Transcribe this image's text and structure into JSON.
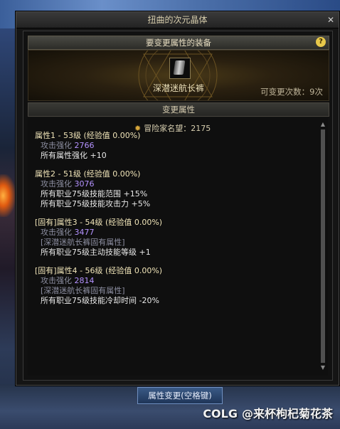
{
  "window": {
    "title": "扭曲的次元晶体"
  },
  "equipment": {
    "header": "要变更属性的装备",
    "item_name": "深潜迷航长裤",
    "change_count": "可变更次数：9次"
  },
  "attributes_header": "变更属性",
  "fame": {
    "label": "冒险家名望：2175"
  },
  "attributes": [
    {
      "title": "属性1 - 53级 (经验值 0.00%)",
      "lines": [
        {
          "label": "攻击强化",
          "value": "2766"
        },
        {
          "text": "所有属性强化 +10"
        }
      ]
    },
    {
      "title": "属性2 - 51级 (经验值 0.00%)",
      "lines": [
        {
          "label": "攻击强化",
          "value": "3076"
        },
        {
          "text": "所有职业75级技能范围 +15%"
        },
        {
          "text": "所有职业75级技能攻击力 +5%"
        }
      ]
    },
    {
      "title": "[固有]属性3 - 54级 (经验值 0.00%)",
      "lines": [
        {
          "label": "攻击强化",
          "value": "3477"
        },
        {
          "fixed": "[深潜迷航长裤固有属性]"
        },
        {
          "text": "所有职业75级主动技能等级 +1"
        }
      ]
    },
    {
      "title": "[固有]属性4 - 56级 (经验值 0.00%)",
      "lines": [
        {
          "label": "攻击强化",
          "value": "2814"
        },
        {
          "fixed": "[深潜迷航长裤固有属性]"
        },
        {
          "text": "所有职业75级技能冷却时间 -20%"
        }
      ]
    }
  ],
  "footer": {
    "button_label": "属性变更(空格键)"
  },
  "watermark": {
    "logo": "COLG",
    "text": "@来杯枸杞菊花茶"
  },
  "icons": {
    "close": "close-icon",
    "help": "help-icon",
    "fame": "fame-icon",
    "item": "pants-icon"
  },
  "colors": {
    "value_purple": "#b492ff",
    "title_gold": "#f0e4b8",
    "button_blue": "#2a4570"
  }
}
